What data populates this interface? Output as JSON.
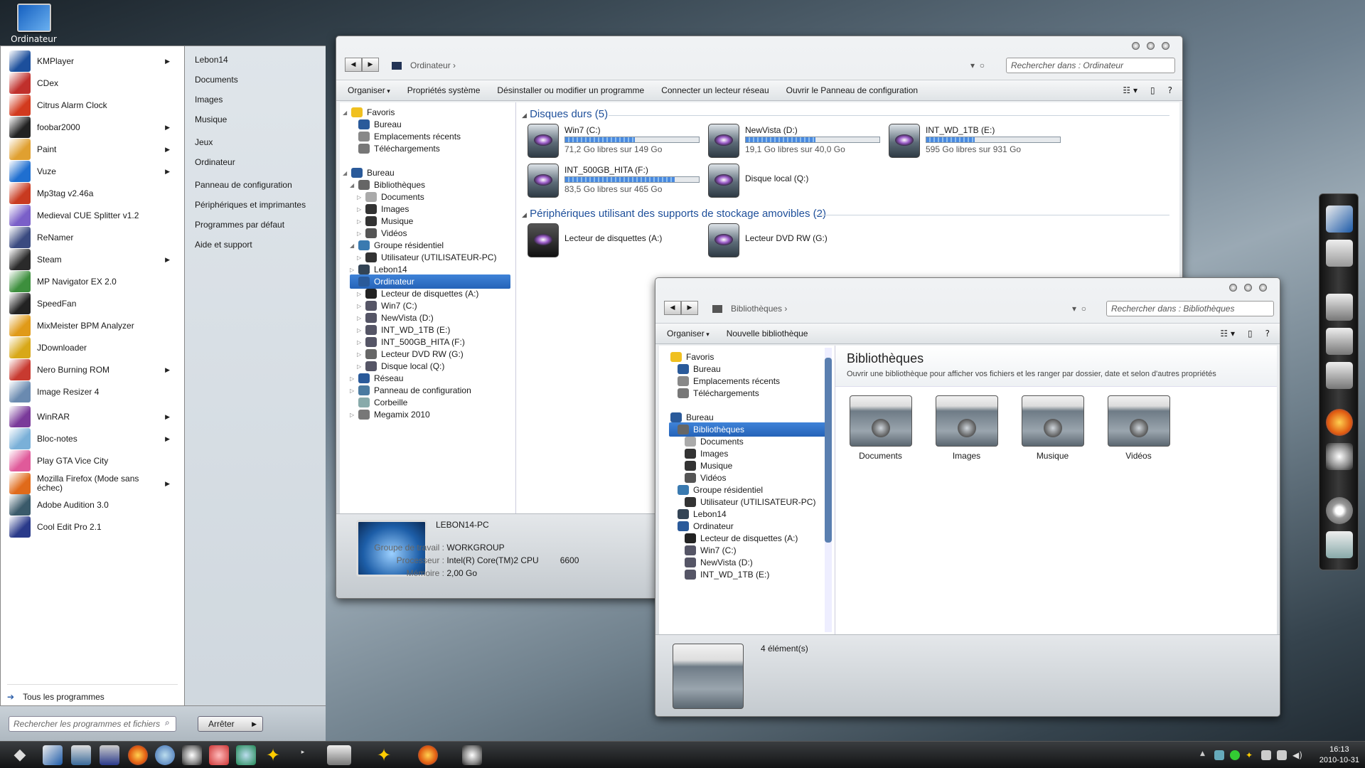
{
  "desktop": {
    "computer_label": "Ordinateur"
  },
  "start_menu": {
    "programs": [
      {
        "label": "KMPlayer",
        "icon": "kmplayer-icon",
        "color": "#1c4f9c",
        "submenu": true
      },
      {
        "label": "CDex",
        "icon": "cdex-icon",
        "color": "#c0302c",
        "submenu": false
      },
      {
        "label": "Citrus Alarm Clock",
        "icon": "alarm-clock-icon",
        "color": "#d23a1e",
        "submenu": false
      },
      {
        "label": "foobar2000",
        "icon": "alien-icon",
        "color": "#222222",
        "submenu": true
      },
      {
        "label": "Paint",
        "icon": "paint-icon",
        "color": "#e0a030",
        "submenu": true
      },
      {
        "label": "Vuze",
        "icon": "vuze-icon",
        "color": "#1f6fd0",
        "submenu": true
      },
      {
        "label": "Mp3tag v2.46a",
        "icon": "mp3tag-icon",
        "color": "#c83a20",
        "submenu": false
      },
      {
        "label": "Medieval CUE Splitter v1.2",
        "icon": "cue-icon",
        "color": "#7a5fc8",
        "submenu": false
      },
      {
        "label": "ReNamer",
        "icon": "renamer-icon",
        "color": "#3a4a80",
        "submenu": false
      },
      {
        "label": "Steam",
        "icon": "steam-icon",
        "color": "#2a2a2a",
        "submenu": true
      },
      {
        "label": "MP Navigator EX 2.0",
        "icon": "mp-navigator-icon",
        "color": "#3d8f3d",
        "submenu": false
      },
      {
        "label": "SpeedFan",
        "icon": "speedfan-icon",
        "color": "#222222",
        "submenu": false
      },
      {
        "label": "MixMeister BPM Analyzer",
        "icon": "mixmeister-icon",
        "color": "#e09a18",
        "submenu": false
      },
      {
        "label": "JDownloader",
        "icon": "jdownloader-icon",
        "color": "#d8a818",
        "submenu": false
      },
      {
        "label": "Nero Burning ROM",
        "icon": "nero-icon",
        "color": "#c83a30",
        "submenu": true
      },
      {
        "label": "Image Resizer 4",
        "icon": "image-resizer-icon",
        "color": "#6a8ab0",
        "submenu": false
      },
      {
        "label": "WinRAR",
        "icon": "winrar-icon",
        "color": "#7a3a9a",
        "submenu": true
      },
      {
        "label": "Bloc-notes",
        "icon": "notepad-icon",
        "color": "#7ab0d8",
        "submenu": true
      },
      {
        "label": "Play GTA Vice City",
        "icon": "gta-icon",
        "color": "#e05a9a",
        "submenu": false
      },
      {
        "label": "Mozilla Firefox (Mode sans échec)",
        "icon": "firefox-icon",
        "color": "#e06a1a",
        "submenu": true
      },
      {
        "label": "Adobe Audition 3.0",
        "icon": "audition-icon",
        "color": "#3a5a6a",
        "submenu": false
      },
      {
        "label": "Cool Edit Pro 2.1",
        "icon": "cool-edit-icon",
        "color": "#2a3a8a",
        "submenu": false
      }
    ],
    "all_programs": "Tous les programmes",
    "right_links": [
      "Lebon14",
      "Documents",
      "Images",
      "Musique",
      "Jeux",
      "Ordinateur",
      "Panneau de configuration",
      "Périphériques et imprimantes",
      "Programmes par défaut",
      "Aide et support"
    ],
    "search_placeholder": "Rechercher les programmes et fichiers",
    "shutdown": "Arrêter"
  },
  "explorer1": {
    "breadcrumb": "Ordinateur",
    "search_placeholder": "Rechercher dans : Ordinateur",
    "toolbar": [
      "Organiser",
      "Propriétés système",
      "Désinstaller ou modifier un programme",
      "Connecter un lecteur réseau",
      "Ouvrir le Panneau de configuration"
    ],
    "tree": [
      "Favoris",
      "Bureau",
      "Emplacements récents",
      "Téléchargements",
      "Bureau",
      "Bibliothèques",
      "Documents",
      "Images",
      "Musique",
      "Vidéos",
      "Groupe résidentiel",
      "Utilisateur (UTILISATEUR-PC)",
      "Lebon14",
      "Ordinateur",
      "Lecteur de disquettes (A:)",
      "Win7 (C:)",
      "NewVista (D:)",
      "INT_WD_1TB (E:)",
      "INT_500GB_HITA (F:)",
      "Lecteur DVD RW (G:)",
      "Disque local (Q:)",
      "Réseau",
      "Panneau de configuration",
      "Corbeille",
      "Megamix 2010"
    ],
    "hard_drives_header": "Disques durs (5)",
    "removable_header": "Périphériques utilisant des supports de stockage amovibles (2)",
    "drives": [
      {
        "name": "Win7 (C:)",
        "free": "71,2 Go libres sur 149 Go",
        "used_fraction": 0.52
      },
      {
        "name": "NewVista (D:)",
        "free": "19,1 Go libres sur 40,0 Go",
        "used_fraction": 0.52
      },
      {
        "name": "INT_WD_1TB (E:)",
        "free": "595 Go libres sur 931 Go",
        "used_fraction": 0.36
      },
      {
        "name": "INT_500GB_HITA (F:)",
        "free": "83,5 Go libres sur 465 Go",
        "used_fraction": 0.82
      },
      {
        "name": "Disque local (Q:)",
        "free": "",
        "used_fraction": null
      }
    ],
    "removable": [
      "Lecteur de disquettes (A:)",
      "Lecteur DVD RW (G:)"
    ],
    "details": {
      "pc_name": "LEBON14-PC",
      "workgroup_label": "Groupe de travail :",
      "workgroup": "WORKGROUP",
      "cpu_label": "Processeur :",
      "cpu": "Intel(R) Core(TM)2 CPU",
      "cpu_model": "6600",
      "memory_label": "Mémoire :",
      "memory": "2,00 Go"
    }
  },
  "explorer2": {
    "breadcrumb": "Bibliothèques",
    "search_placeholder": "Rechercher dans : Bibliothèques",
    "toolbar": [
      "Organiser",
      "Nouvelle bibliothèque"
    ],
    "tree": [
      "Favoris",
      "Bureau",
      "Emplacements récents",
      "Téléchargements",
      "Bureau",
      "Bibliothèques",
      "Documents",
      "Images",
      "Musique",
      "Vidéos",
      "Groupe résidentiel",
      "Utilisateur (UTILISATEUR-PC)",
      "Lebon14",
      "Ordinateur",
      "Lecteur de disquettes (A:)",
      "Win7 (C:)",
      "NewVista (D:)",
      "INT_WD_1TB (E:)"
    ],
    "title": "Bibliothèques",
    "subtitle": "Ouvrir une bibliothèque pour afficher vos fichiers et les ranger par dossier, date et selon d'autres propriétés",
    "libraries": [
      "Documents",
      "Images",
      "Musique",
      "Vidéos"
    ],
    "status": "4 élément(s)"
  },
  "taskbar": {
    "time": "16:13",
    "date": "2010-10-31"
  }
}
